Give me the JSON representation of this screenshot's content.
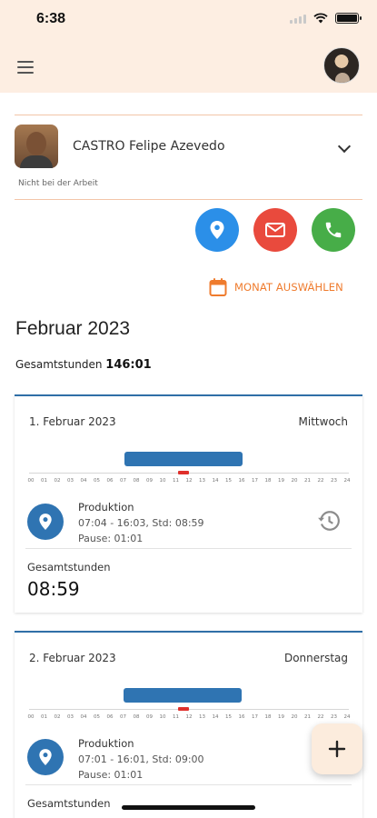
{
  "status_bar": {
    "time": "6:38"
  },
  "employee": {
    "name": "CASTRO Felipe Azevedo",
    "status": "Nicht bei der Arbeit"
  },
  "actions": {
    "month_select_label": "MONAT AUSWÄHLEN"
  },
  "colors": {
    "accent": "#ef7b2d",
    "header_bg": "#fdeee2",
    "primary_blue": "#2f74b2",
    "location_button": "#2b8fe8",
    "mail_button": "#e94a3d",
    "phone_button": "#47ad48",
    "now_marker": "#e0302b"
  },
  "icons": {
    "menu": "hamburger-menu-icon",
    "expand": "chevron-down-icon",
    "location": "map-pin-icon",
    "mail": "envelope-icon",
    "phone": "phone-icon",
    "calendar": "calendar-icon",
    "history": "history-icon",
    "add": "plus-icon"
  },
  "month": {
    "title": "Februar 2023",
    "total_label": "Gesamtstunden",
    "total_value": "146:01"
  },
  "timeline_hours": [
    "00",
    "01",
    "02",
    "03",
    "04",
    "05",
    "06",
    "07",
    "08",
    "09",
    "10",
    "11",
    "12",
    "13",
    "14",
    "15",
    "16",
    "17",
    "18",
    "19",
    "20",
    "21",
    "22",
    "23",
    "24"
  ],
  "days": [
    {
      "date": "1. Februar 2023",
      "weekday": "Mittwoch",
      "work_start_hour": 7.07,
      "work_end_hour": 16.05,
      "now_marker_hour": 11.6,
      "entry_type": "Produktion",
      "entry_time": "07:04 - 16:03, Std: 08:59",
      "entry_pause": "Pause: 01:01",
      "total_label": "Gesamtstunden",
      "total_value": "08:59"
    },
    {
      "date": "2. Februar 2023",
      "weekday": "Donnerstag",
      "work_start_hour": 7.02,
      "work_end_hour": 16.02,
      "now_marker_hour": 11.6,
      "entry_type": "Produktion",
      "entry_time": "07:01 - 16:01, Std: 09:00",
      "entry_pause": "Pause: 01:01",
      "total_label": "Gesamtstunden",
      "total_value": ""
    }
  ]
}
